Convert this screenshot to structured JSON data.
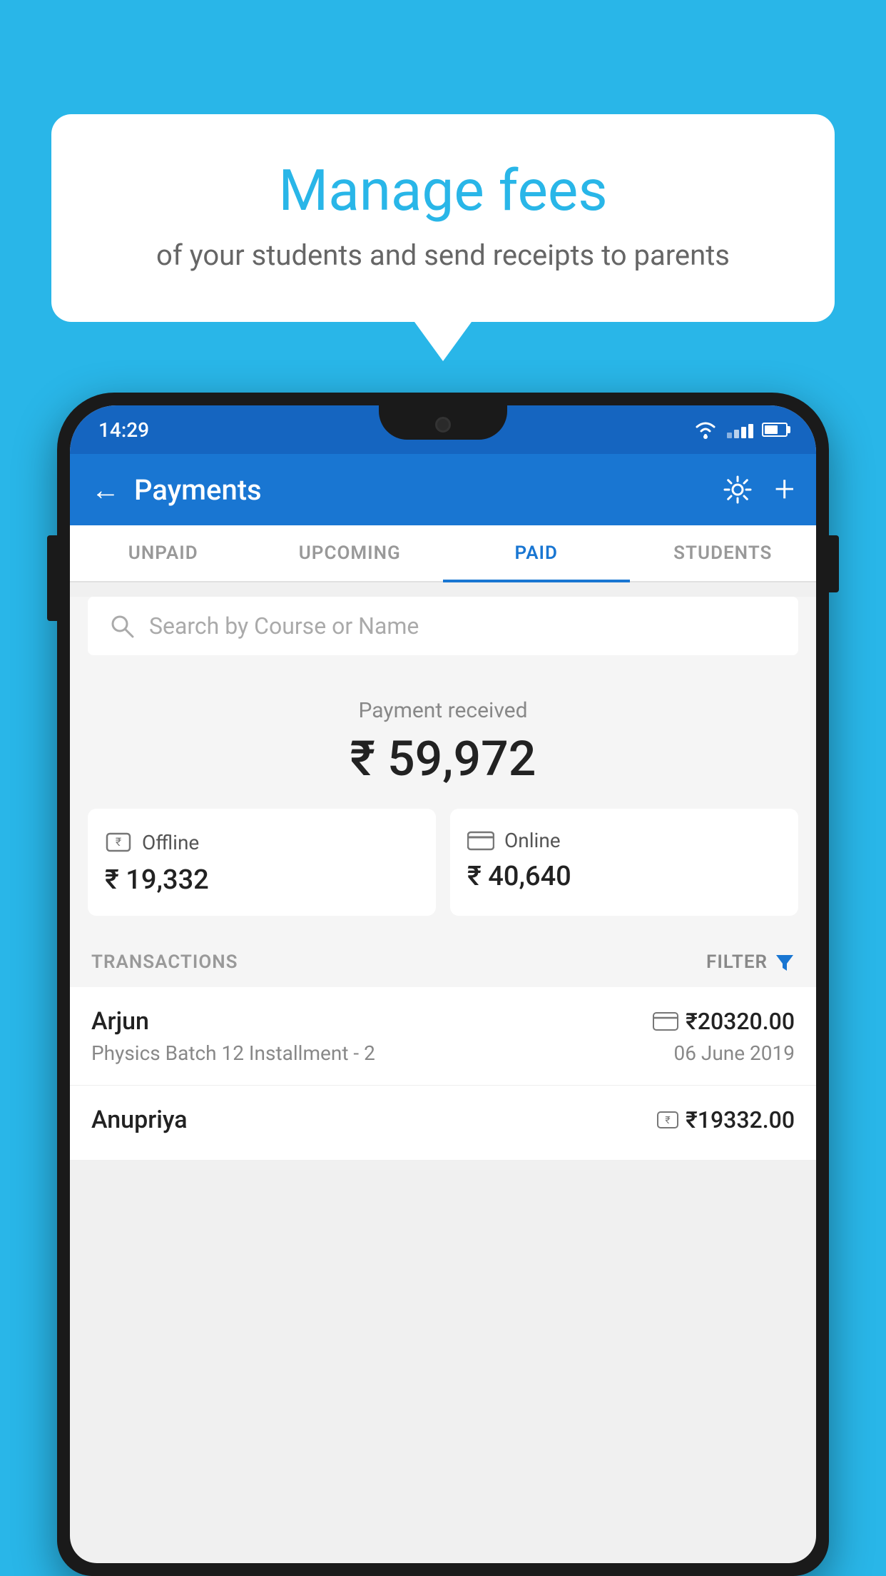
{
  "background_color": "#29B6E8",
  "speech_bubble": {
    "title": "Manage fees",
    "subtitle": "of your students and send receipts to parents"
  },
  "status_bar": {
    "time": "14:29"
  },
  "app_bar": {
    "title": "Payments",
    "back_label": "←"
  },
  "tabs": [
    {
      "id": "unpaid",
      "label": "UNPAID",
      "active": false
    },
    {
      "id": "upcoming",
      "label": "UPCOMING",
      "active": false
    },
    {
      "id": "paid",
      "label": "PAID",
      "active": true
    },
    {
      "id": "students",
      "label": "STUDENTS",
      "active": false
    }
  ],
  "search": {
    "placeholder": "Search by Course or Name"
  },
  "payment_received": {
    "label": "Payment received",
    "amount": "₹ 59,972"
  },
  "payment_cards": [
    {
      "id": "offline",
      "label": "Offline",
      "amount": "₹ 19,332"
    },
    {
      "id": "online",
      "label": "Online",
      "amount": "₹ 40,640"
    }
  ],
  "transactions": {
    "header": "TRANSACTIONS",
    "filter_label": "FILTER",
    "rows": [
      {
        "name": "Arjun",
        "amount": "₹20320.00",
        "course": "Physics Batch 12 Installment - 2",
        "date": "06 June 2019",
        "payment_type": "card"
      },
      {
        "name": "Anupriya",
        "amount": "₹19332.00",
        "course": "",
        "date": "",
        "payment_type": "rupee"
      }
    ]
  }
}
